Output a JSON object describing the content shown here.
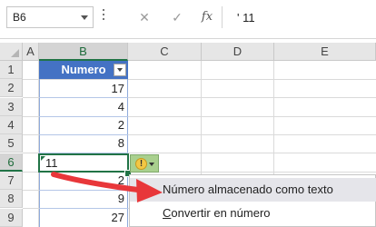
{
  "formula_bar": {
    "name_box": "B6",
    "cancel_glyph": "✕",
    "enter_glyph": "✓",
    "fx_label": "fx",
    "formula_value": "' 11"
  },
  "sheet": {
    "columns": [
      "A",
      "B",
      "C",
      "D",
      "E"
    ],
    "rows": [
      "1",
      "2",
      "3",
      "4",
      "5",
      "6",
      "7",
      "8",
      "9",
      "10"
    ],
    "table_header": "Numero",
    "values": [
      "17",
      "4",
      "2",
      "8",
      "11",
      "2",
      "9",
      "27"
    ]
  },
  "error_button": {
    "icon": "warning-icon",
    "glyph": "!"
  },
  "context_menu": {
    "items": [
      {
        "label": "Número almacenado como texto",
        "highlighted": true
      },
      {
        "label_prefix": "",
        "label_underline": "C",
        "label_rest": "onvertir en número",
        "highlighted": false
      }
    ]
  },
  "colors": {
    "table_header_bg": "#4472c4",
    "selection": "#217346",
    "error_button_bg": "#a9d08e",
    "arrow": "#e8373a"
  }
}
